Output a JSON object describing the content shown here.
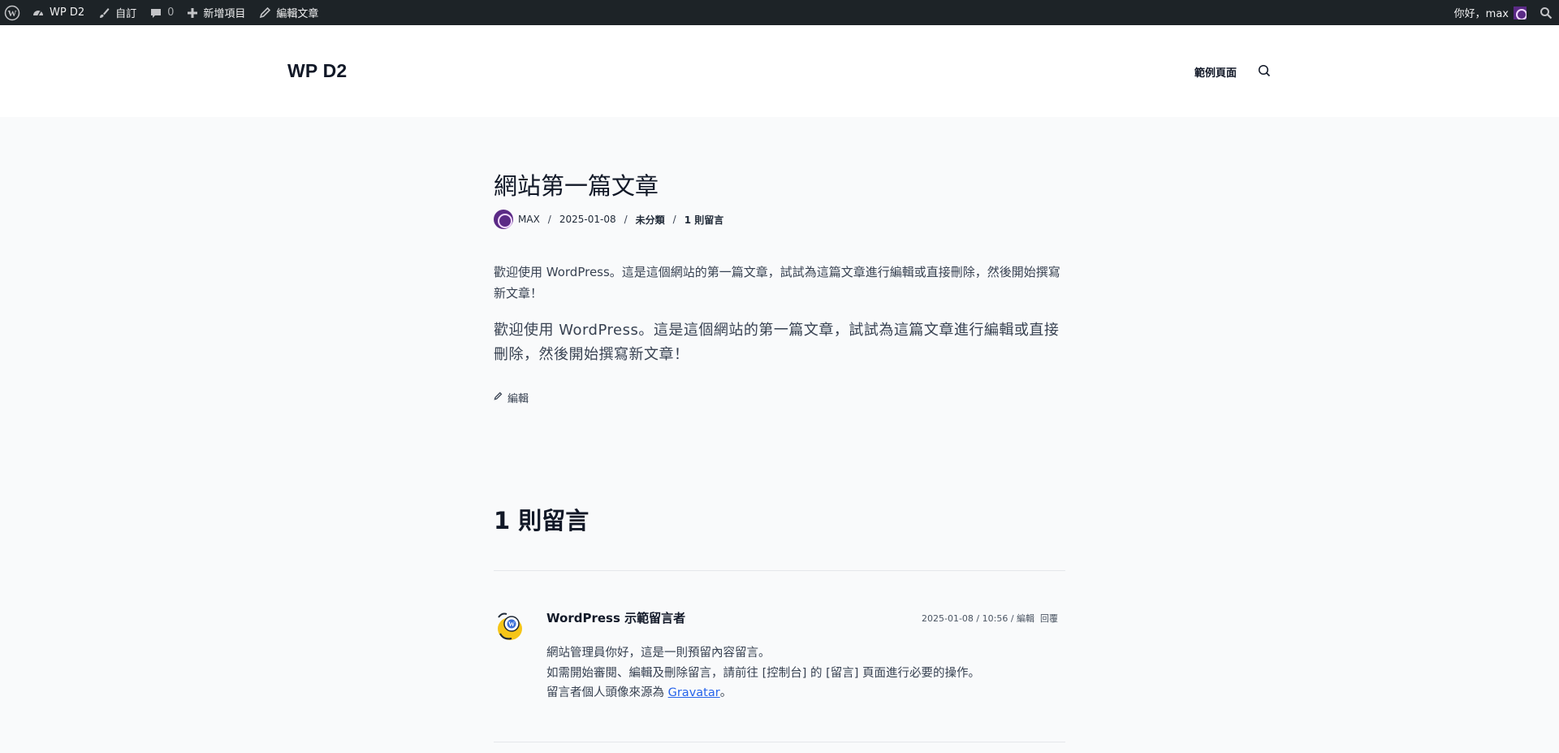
{
  "admin_bar": {
    "site_name": "WP D2",
    "customize": "自訂",
    "comments_count": "0",
    "new_item": "新增項目",
    "edit_post": "編輯文章",
    "greeting": "你好，max"
  },
  "header": {
    "site_title": "WP D2",
    "nav_item": "範例頁面"
  },
  "post": {
    "title": "網站第一篇文章",
    "author": "MAX",
    "date": "2025-01-08",
    "category": "未分類",
    "comments_link": "1 則留言",
    "paragraph_1": "歡迎使用 WordPress。這是這個網站的第一篇文章，試試為這篇文章進行編輯或直接刪除，然後開始撰寫新文章！",
    "paragraph_2": "歡迎使用 WordPress。這是這個網站的第一篇文章，試試為這篇文章進行編輯或直接刪除，然後開始撰寫新文章！",
    "edit_label": "編輯"
  },
  "comments": {
    "count": "1",
    "title_suffix": "則留言",
    "items": [
      {
        "author": "WordPress 示範留言者",
        "datetime": "2025-01-08 / 10:56 / 編輯",
        "reply": "回覆",
        "line_1": "網站管理員你好，這是一則預留內容留言。",
        "line_2": "如需開始審閱、編輯及刪除留言，請前往 [控制台] 的 [留言] 頁面進行必要的操作。",
        "line_3_prefix": "留言者個人頭像來源為",
        "line_3_link": "Gravatar",
        "line_3_suffix": "。"
      }
    ]
  },
  "colors": {
    "admin_bar_bg": "#1d2327",
    "page_bg": "#f9fafb",
    "header_bg": "#ffffff",
    "link": "#2563eb"
  }
}
